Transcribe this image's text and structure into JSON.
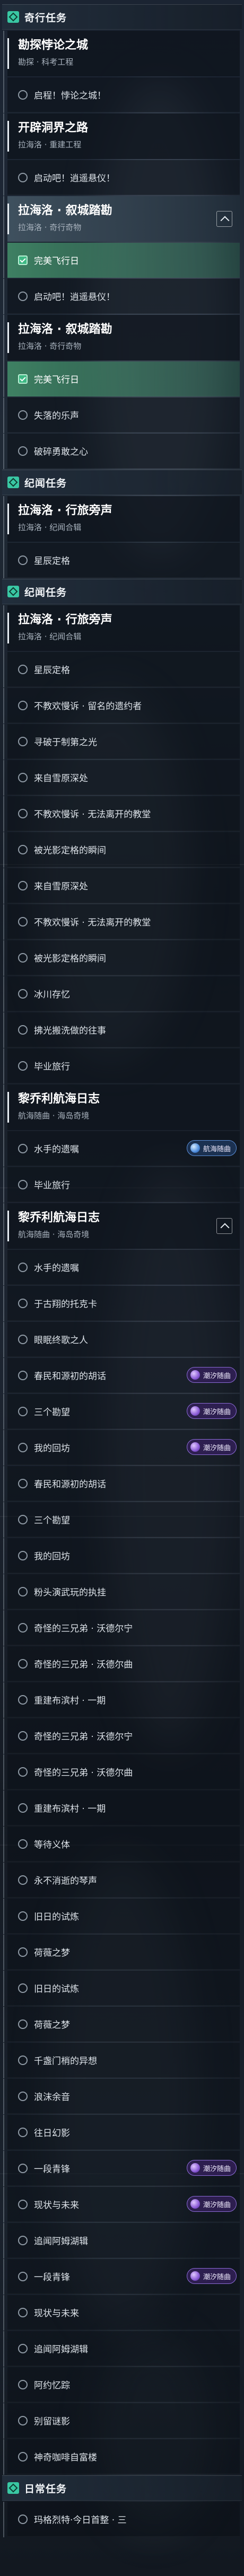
{
  "colors": {
    "section_icon": "#39c7a3",
    "selected_item": "#46966e",
    "badge_purple": "#8d6cd8",
    "badge_blue": "#5b8fd8"
  },
  "icons": {
    "section": "quest-section-icon",
    "item": "quest-status-circle-icon",
    "item_selected": "quest-tracking-icon",
    "card_toggle": "chevron-up-icon",
    "badge": "region-emblem-icon"
  },
  "list": [
    {
      "type": "header",
      "label": "奇行任务"
    },
    {
      "type": "card",
      "title": "勘探悖论之城",
      "subtitle": "勘探 · 科考工程"
    },
    {
      "type": "item",
      "label": "启程！悖论之城！"
    },
    {
      "type": "card",
      "title": "开辟洞界之路",
      "subtitle": "拉海洛 · 重建工程"
    },
    {
      "type": "item",
      "label": "启动吧！逍遥悬仪！"
    },
    {
      "type": "card",
      "title": "拉海洛 · 叙城踏勘",
      "subtitle": "拉海洛 · 奇行奇物",
      "active": true,
      "collapsible": true
    },
    {
      "type": "item",
      "label": "完美飞行日",
      "selected": true
    },
    {
      "type": "item",
      "label": "启动吧！逍遥悬仪！"
    },
    {
      "type": "card",
      "title": "拉海洛 · 叙城踏勘",
      "subtitle": "拉海洛 · 奇行奇物"
    },
    {
      "type": "item",
      "label": "完美飞行日",
      "selected": true
    },
    {
      "type": "item",
      "label": "失落的乐声"
    },
    {
      "type": "item",
      "label": "破碎勇敢之心"
    },
    {
      "type": "header",
      "label": "纪闻任务"
    },
    {
      "type": "card",
      "title": "拉海洛 · 行旅旁声",
      "subtitle": "拉海洛 · 纪闻合辑"
    },
    {
      "type": "item",
      "label": "星辰定格"
    },
    {
      "type": "header",
      "label": "纪闻任务"
    },
    {
      "type": "card",
      "title": "拉海洛 · 行旅旁声",
      "subtitle": "拉海洛 · 纪闻合辑"
    },
    {
      "type": "item",
      "label": "星辰定格"
    },
    {
      "type": "item",
      "label": "不教欢慢诉 · 留名的遗约者"
    },
    {
      "type": "item",
      "label": "寻破于制第之光"
    },
    {
      "type": "item",
      "label": "来自雪原深处"
    },
    {
      "type": "item",
      "label": "不教欢慢诉 · 无法离开的教堂"
    },
    {
      "type": "item",
      "label": "被光影定格的瞬间"
    },
    {
      "type": "item",
      "label": "来自雪原深处"
    },
    {
      "type": "item",
      "label": "不教欢慢诉 · 无法离开的教堂"
    },
    {
      "type": "item",
      "label": "被光影定格的瞬间"
    },
    {
      "type": "item",
      "label": "冰川存忆"
    },
    {
      "type": "item",
      "label": "拂光搬洗做的往事"
    },
    {
      "type": "item",
      "label": "毕业旅行"
    },
    {
      "type": "card",
      "title": "黎乔利航海日志",
      "subtitle": "航海随曲 · 海岛奇境"
    },
    {
      "type": "item",
      "label": "水手的遗嘱",
      "badge": {
        "label": "航海随曲",
        "tone": "blue"
      }
    },
    {
      "type": "item",
      "label": "毕业旅行"
    },
    {
      "type": "card",
      "title": "黎乔利航海日志",
      "subtitle": "航海随曲 · 海岛奇境",
      "collapsible": true
    },
    {
      "type": "item",
      "label": "水手的遗嘱"
    },
    {
      "type": "item",
      "label": "于古翔的托克卡"
    },
    {
      "type": "item",
      "label": "眼眠终歌之人"
    },
    {
      "type": "item",
      "label": "春民和源初的胡话",
      "badge": {
        "label": "潮汐随曲",
        "tone": "purple"
      }
    },
    {
      "type": "item",
      "label": "三个勘望",
      "badge": {
        "label": "潮汐随曲",
        "tone": "purple"
      }
    },
    {
      "type": "item",
      "label": "我的回坊",
      "badge": {
        "label": "潮汐随曲",
        "tone": "purple"
      }
    },
    {
      "type": "item",
      "label": "春民和源初的胡话"
    },
    {
      "type": "item",
      "label": "三个勘望"
    },
    {
      "type": "item",
      "label": "我的回坊"
    },
    {
      "type": "item",
      "label": "粉头演武玩的执挂"
    },
    {
      "type": "item",
      "label": "奇怪的三兄弟 · 沃德尔宁"
    },
    {
      "type": "item",
      "label": "奇怪的三兄弟 · 沃德尔曲"
    },
    {
      "type": "item",
      "label": "重建布滨村 · 一期"
    },
    {
      "type": "item",
      "label": "奇怪的三兄弟 · 沃德尔宁"
    },
    {
      "type": "item",
      "label": "奇怪的三兄弟 · 沃德尔曲"
    },
    {
      "type": "item",
      "label": "重建布滨村 · 一期"
    },
    {
      "type": "item",
      "label": "等待义体"
    },
    {
      "type": "item",
      "label": "永不消逝的琴声"
    },
    {
      "type": "item",
      "label": "旧日的试炼"
    },
    {
      "type": "item",
      "label": "荷薇之梦"
    },
    {
      "type": "item",
      "label": "旧日的试炼"
    },
    {
      "type": "item",
      "label": "荷薇之梦"
    },
    {
      "type": "item",
      "label": "千盏门梢的异想"
    },
    {
      "type": "item",
      "label": "浪沫余音"
    },
    {
      "type": "item",
      "label": "往日幻影"
    },
    {
      "type": "item",
      "label": "一段青锋",
      "badge": {
        "label": "潮汐随曲",
        "tone": "purple"
      }
    },
    {
      "type": "item",
      "label": "现状与未来",
      "badge": {
        "label": "潮汐随曲",
        "tone": "purple"
      }
    },
    {
      "type": "item",
      "label": "追闻阿姆湖辑"
    },
    {
      "type": "item",
      "label": "一段青锋",
      "badge": {
        "label": "潮汐随曲",
        "tone": "purple"
      }
    },
    {
      "type": "item",
      "label": "现状与未来"
    },
    {
      "type": "item",
      "label": "追闻阿姆湖辑"
    },
    {
      "type": "item",
      "label": "阿约忆踪"
    },
    {
      "type": "item",
      "label": "别留谜影"
    },
    {
      "type": "item",
      "label": "神奇咖啡自富楼"
    },
    {
      "type": "header",
      "label": "日常任务"
    },
    {
      "type": "item",
      "label": "玛格烈特·今日首整 · 三"
    }
  ]
}
